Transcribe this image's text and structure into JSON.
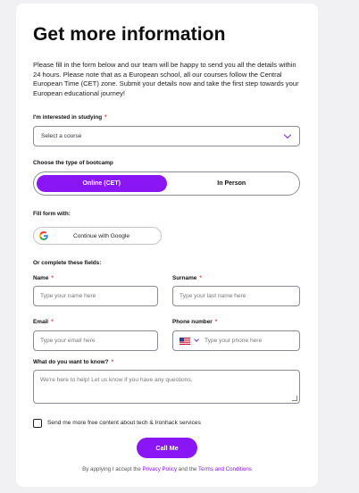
{
  "form": {
    "title": "Get more information",
    "intro": "Please fill in the form below and our team will be happy to send you all the details within 24 hours. Please note that as a European school, all our courses follow the Central European Time (CET) zone. Submit your details now and take the first step towards your European educational journey!",
    "course_label": "I'm interested in studying",
    "required_mark": "*",
    "course_select_value": "Select a course",
    "bootcamp_label": "Choose the type of bootcamp",
    "bootcamp_options": [
      "Online (CET)",
      "In Person"
    ],
    "fill_with_label": "Fill form with:",
    "google_button": "Continue with Google",
    "complete_label": "Or complete these fields:",
    "name_label": "Name",
    "name_placeholder": "Type your name here",
    "surname_label": "Surname",
    "surname_placeholder": "Type your last name here",
    "email_label": "Email",
    "email_placeholder": "Type your email here",
    "phone_label": "Phone number",
    "phone_placeholder": "Type your phone here",
    "question_label": "What do you want to know?",
    "question_placeholder": "We're here to help! Let us know if you have any questions.",
    "newsletter_label": "Send me more free content about tech & Ironhack services",
    "submit_button": "Call Me",
    "legal_prefix": "By applying I accept the",
    "privacy_link": "Privacy Policy",
    "legal_and": "and the",
    "terms_link": "Terms and Conditions"
  },
  "colors": {
    "accent": "#8a16f5",
    "required": "#e23b3b",
    "border": "#8b8b96"
  },
  "icons": [
    "chevron-down-icon",
    "google-icon",
    "us-flag-icon"
  ]
}
